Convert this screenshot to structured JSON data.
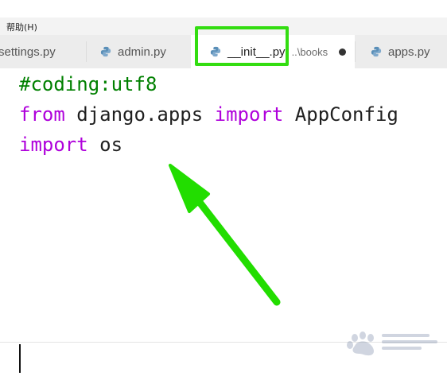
{
  "menu": {
    "help_label": "帮助(H)"
  },
  "tabs": [
    {
      "label": "settings.py",
      "icon": "python-icon",
      "active": false
    },
    {
      "label": "admin.py",
      "icon": "python-icon",
      "active": false
    },
    {
      "label": "__init__.py",
      "description": "..\\books",
      "icon": "python-icon",
      "active": true,
      "unsaved": true
    },
    {
      "label": "apps.py",
      "icon": "python-icon",
      "active": false
    }
  ],
  "editor": {
    "lines": [
      [
        {
          "t": "#coding:utf8"
        }
      ],
      [
        {
          "t": "from"
        },
        {
          "t": " django.apps "
        },
        {
          "t": "import"
        },
        {
          "t": " AppConfig"
        }
      ],
      [
        {
          "t": "import"
        },
        {
          "t": " os"
        }
      ]
    ]
  },
  "annotation": {
    "highlight_color": "#33dd11",
    "arrow_color": "#22dd00",
    "highlight_target": "__init__.py"
  },
  "watermark": {
    "icon": "baidu-paw-icon"
  },
  "colors": {
    "comment": "#008000",
    "keyword": "#af00db",
    "text": "#1f1f1f"
  }
}
